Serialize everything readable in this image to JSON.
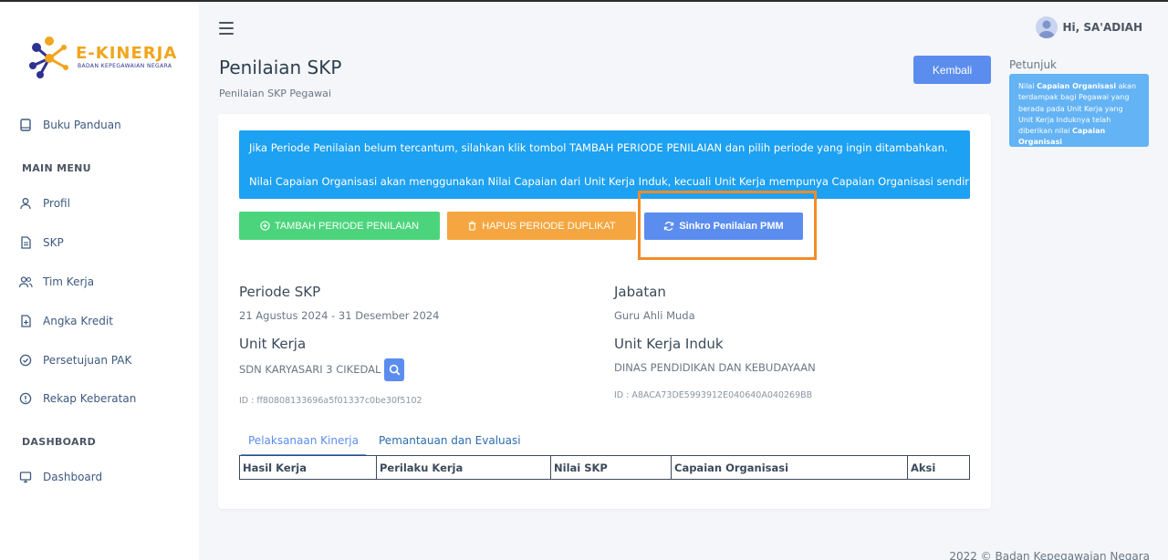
{
  "app": {
    "logo_title": "E-KINERJA",
    "logo_subtitle": "BADAN KEPEGAWAIAN NEGARA"
  },
  "sidebar": {
    "guide": "Buku Panduan",
    "main_menu_heading": "MAIN MENU",
    "items": [
      {
        "label": "Profil",
        "icon": "user-icon"
      },
      {
        "label": "SKP",
        "icon": "document-icon"
      },
      {
        "label": "Tim Kerja",
        "icon": "users-icon"
      },
      {
        "label": "Angka Kredit",
        "icon": "file-plus-icon"
      },
      {
        "label": "Persetujuan PAK",
        "icon": "check-circle-icon"
      },
      {
        "label": "Rekap Keberatan",
        "icon": "info-circle-icon"
      }
    ],
    "dashboard_heading": "DASHBOARD",
    "dashboard_item": "Dashboard"
  },
  "header": {
    "user_greeting": "Hi, SA'ADIAH"
  },
  "page": {
    "title": "Penilaian SKP",
    "subtitle": "Penilaian SKP Pegawai",
    "back_button": "Kembali"
  },
  "petunjuk": {
    "label": "Petunjuk",
    "text_1": "Nilai ",
    "bold_1": "Capaian Organisasi",
    "text_2": " akan terdampak bagi Pegawai yang berada pada Unit Kerja yang Unit Kerja Induknya telah diberikan nilai ",
    "bold_2": "Capaian Organisasi"
  },
  "alert": {
    "line_1": "Jika Periode Penilaian belum tercantum, silahkan klik tombol TAMBAH PERIODE PENILAIAN dan pilih periode yang ingin ditambahkan.",
    "line_2": "Nilai Capaian Organisasi akan menggunakan Nilai Capaian dari Unit Kerja Induk, kecuali Unit Kerja mempunya Capaian Organisasi sendiri."
  },
  "actions": {
    "add_period": "TAMBAH PERIODE PENILAIAN",
    "delete_duplicate": "HAPUS PERIODE DUPLIKAT",
    "sync_pmm": "Sinkro Penilaian PMM"
  },
  "details": {
    "periode_label": "Periode SKP",
    "periode_value": "21 Agustus 2024 - 31 Desember 2024",
    "jabatan_label": "Jabatan",
    "jabatan_value": "Guru Ahli Muda",
    "unit_label": "Unit Kerja",
    "unit_value": "SDN KARYASARI 3 CIKEDAL",
    "unit_id": "ID : ff80808133696a5f01337c0be30f5102",
    "unit_induk_label": "Unit Kerja Induk",
    "unit_induk_value": "DINAS PENDIDIKAN DAN KEBUDAYAAN",
    "unit_induk_id": "ID : A8ACA73DE5993912E040640A040269BB"
  },
  "tabs": [
    "Pelaksanaan Kinerja",
    "Pemantauan dan Evaluasi"
  ],
  "table": {
    "columns": [
      "Hasil Kerja",
      "Perilaku Kerja",
      "Nilai SKP",
      "Capaian Organisasi",
      "Aksi"
    ]
  },
  "footer": "2022 © Badan Kepegawaian Negara",
  "colors": {
    "primary": "#5b8def",
    "alert": "#1da1f2",
    "success": "#4cd47c",
    "warning": "#f5a640",
    "highlight": "#f28c28",
    "logo_orange": "#f0a51c",
    "logo_navy": "#2e3192"
  }
}
